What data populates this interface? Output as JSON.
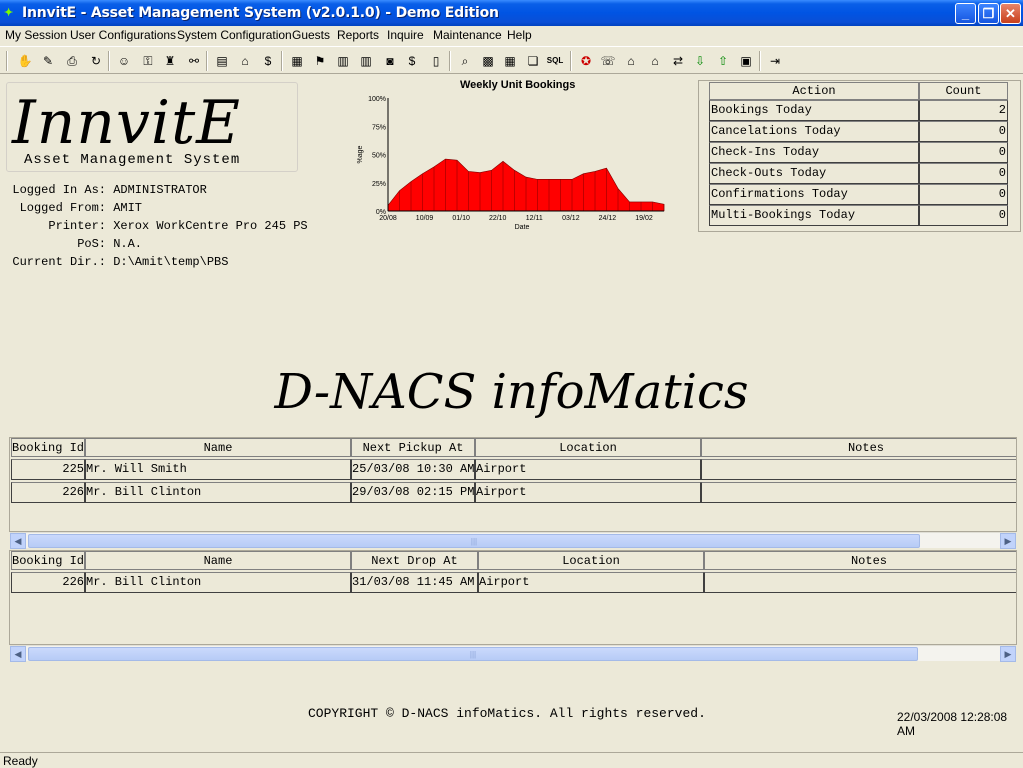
{
  "window": {
    "title": "InnvitE - Asset Management System (v2.0.1.0) - Demo Edition"
  },
  "menu": [
    "My Session",
    "User Configurations",
    "System Configuration",
    "Guests",
    "Reports",
    "Inquire",
    "Maintenance",
    "Help"
  ],
  "logo": {
    "title": "InnvitE",
    "subtitle": "Asset Management System"
  },
  "session": {
    "logged_in_as_label": "Logged In As:",
    "logged_in_as": "ADMINISTRATOR",
    "logged_from_label": "Logged From:",
    "logged_from": "AMIT",
    "printer_label": "Printer:",
    "printer": "Xerox WorkCentre Pro 245 PS",
    "pos_label": "PoS:",
    "pos": "N.A.",
    "current_dir_label": "Current Dir.:",
    "current_dir": "D:\\Amit\\temp\\PBS"
  },
  "chart_data": {
    "type": "area",
    "title": "Weekly Unit Bookings",
    "xlabel": "Date",
    "ylabel": "%age",
    "ylim": [
      0,
      100
    ],
    "y_ticks": [
      "0%",
      "25%",
      "50%",
      "75%",
      "100%"
    ],
    "x_ticks": [
      "20/08",
      "10/09",
      "01/10",
      "22/10",
      "12/11",
      "03/12",
      "24/12",
      "19/02"
    ],
    "color": "#FF0000",
    "values": [
      5,
      18,
      26,
      33,
      39,
      46,
      45,
      35,
      34,
      36,
      44,
      36,
      30,
      28,
      28,
      28,
      28,
      33,
      35,
      38,
      20,
      8,
      8,
      8,
      6
    ]
  },
  "actions": {
    "headers": [
      "Action",
      "Count"
    ],
    "rows": [
      [
        "Bookings Today",
        "2"
      ],
      [
        "Cancelations Today",
        "0"
      ],
      [
        "Check-Ins Today",
        "0"
      ],
      [
        "Check-Outs Today",
        "0"
      ],
      [
        "Confirmations Today",
        "0"
      ],
      [
        "Multi-Bookings Today",
        "0"
      ]
    ]
  },
  "banner": "D-NACS infoMatics",
  "pickups": {
    "headers": [
      "Booking Id",
      "Name",
      "Next Pickup At",
      "Location",
      "Notes"
    ],
    "rows": [
      [
        "225",
        "Mr. Will Smith",
        "25/03/08 10:30 AM",
        "Airport",
        ""
      ],
      [
        "226",
        "Mr. Bill Clinton",
        "29/03/08 02:15 PM",
        "Airport",
        ""
      ]
    ]
  },
  "drops": {
    "headers": [
      "Booking Id",
      "Name",
      "Next Drop At",
      "Location",
      "Notes"
    ],
    "rows": [
      [
        "226",
        "Mr. Bill Clinton",
        "31/03/08 11:45 AM",
        "Airport",
        ""
      ]
    ]
  },
  "footer": {
    "copyright": "COPYRIGHT © D-NACS infoMatics. All rights reserved.",
    "datetime": "22/03/2008 12:28:08 AM"
  },
  "status": "Ready"
}
